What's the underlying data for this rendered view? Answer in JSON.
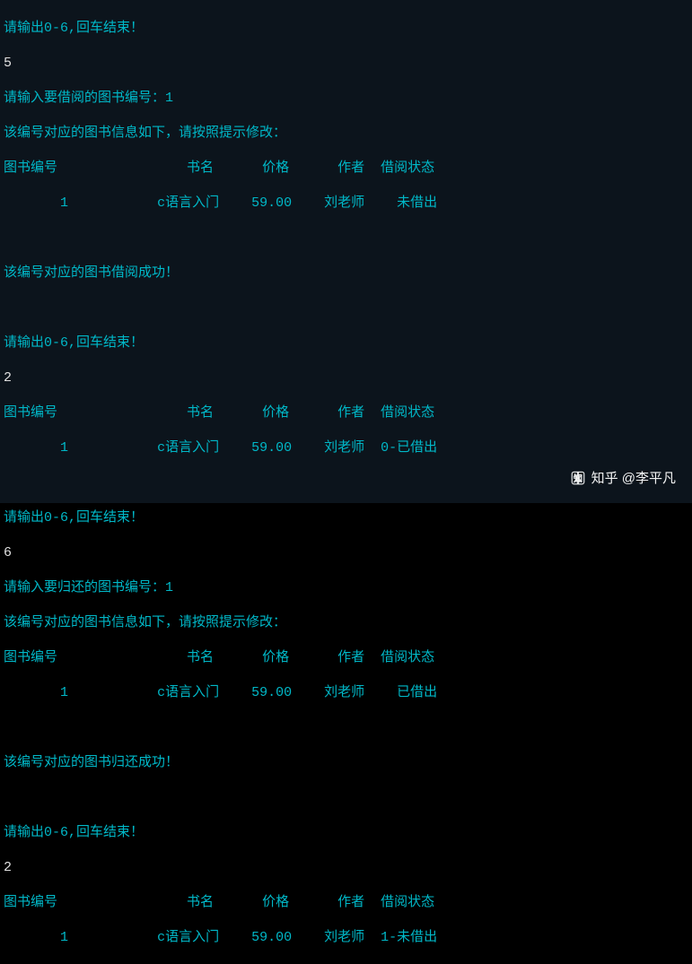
{
  "prompt_main": "请输出0-6,回车结束！",
  "input_5": "5",
  "input_2a": "2",
  "input_6": "6",
  "input_2b": "2",
  "borrow_prompt": "请输入要借阅的图书编号：1",
  "return_prompt": "请输入要归还的图书编号：1",
  "info_line": "该编号对应的图书信息如下，请按照提示修改：",
  "borrow_success": "该编号对应的图书借阅成功！",
  "return_success": "该编号对应的图书归还成功！",
  "header_id": "图书编号",
  "header_name": "书名",
  "header_price": "价格",
  "header_author": "作者",
  "header_status": "借阅状态",
  "row1_id": "1",
  "row1_name": "c语言入门",
  "row1_price": "59.00",
  "row1_author": "刘老师",
  "status_not_borrowed": "未借出",
  "status_borrowed_0": "0-已借出",
  "status_borrowed": "已借出",
  "status_not_borrowed_1": "1-未借出",
  "watermark_text": "知乎 @李平凡"
}
